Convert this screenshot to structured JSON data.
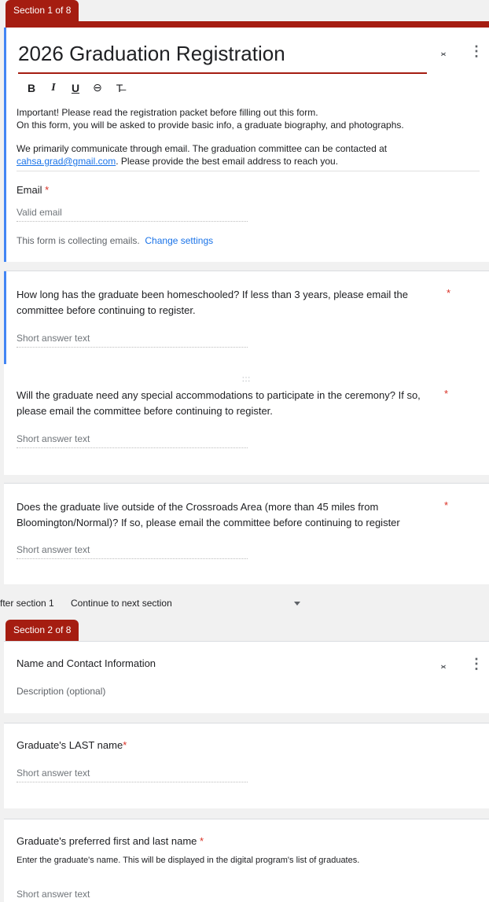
{
  "section1": {
    "tab_label": "Section 1 of 8",
    "title": "2026 Graduation Registration",
    "format_buttons": {
      "bold": "B",
      "italic": "I",
      "underline": "U",
      "link": "⊖",
      "clear": "T̶"
    },
    "description": {
      "line1": "Important! Please read the registration packet before filling out this form.",
      "line2": "On this form, you will be asked to provide basic info, a graduate biography, and photographs.",
      "line3": "We primarily communicate through email. The graduation committee can be contacted at",
      "email_link": "cahsa.grad@gmail.com",
      "line4_rest": ". Please provide the best email address to reach you."
    },
    "email_label": "Email",
    "email_placeholder": "Valid email",
    "collecting_note": "This form is collecting emails.",
    "change_settings": "Change settings"
  },
  "questions": [
    {
      "line1": "How long has the graduate been homeschooled? If less than 3 years, please email the",
      "line2": "committee before continuing to register.",
      "placeholder": "Short answer text"
    },
    {
      "line1": "Will the graduate need any special accommodations to participate in the ceremony? If so,",
      "line2": "please email the committee before continuing to register.",
      "placeholder": "Short answer text"
    },
    {
      "line1": "Does the graduate live outside of the Crossroads Area (more than 45 miles from",
      "line2": "Bloomington/Normal)? If so, please email the committee before continuing to register",
      "placeholder": "Short answer text"
    }
  ],
  "required_mark": "*",
  "drag_handle": ":::",
  "after_section": {
    "label": "fter section 1",
    "value": "Continue to next section"
  },
  "section2": {
    "tab_label": "Section 2 of 8",
    "title": "Name and Contact Information",
    "description_placeholder": "Description (optional)"
  },
  "section2_questions": [
    {
      "label": "Graduate's LAST name",
      "placeholder": "Short answer text"
    },
    {
      "label": "Graduate's preferred first and last name",
      "helper": "Enter the graduate's name. This will be displayed in the digital program's list of graduates.",
      "placeholder": "Short answer text"
    }
  ],
  "icons": {
    "collapse": "collapse-icon",
    "more": "more-vert-icon",
    "dropdown": "arrow-drop-down-icon"
  },
  "colors": {
    "accent": "#a51d11",
    "focus": "#4285f4",
    "link": "#1a73e8",
    "required": "#d93025"
  }
}
